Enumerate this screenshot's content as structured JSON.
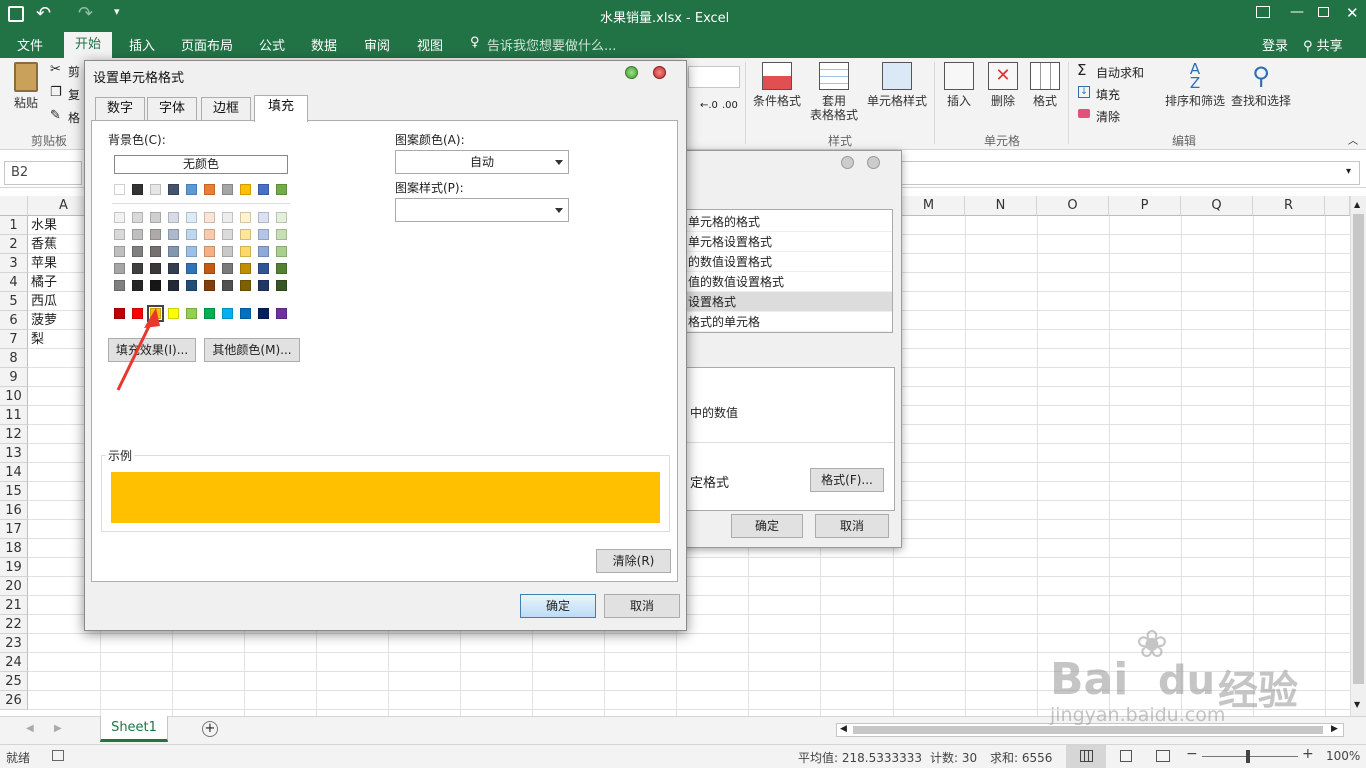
{
  "window": {
    "title": "水果销量.xlsx - Excel",
    "login": "登录",
    "share": "共享"
  },
  "ribbon_tabs": [
    "文件",
    "开始",
    "插入",
    "页面布局",
    "公式",
    "数据",
    "审阅",
    "视图"
  ],
  "tell_me": "告诉我您想要做什么...",
  "clipboard": {
    "paste": "粘贴",
    "cut": "剪",
    "copy": "复",
    "painter": "格",
    "group": "剪贴板"
  },
  "styles": {
    "cond": "条件格式",
    "table_a": "套用",
    "table_b": "表格格式",
    "cell_style": "单元格样式",
    "group": "样式"
  },
  "cells_group": {
    "insert": "插入",
    "delete": "删除",
    "format": "格式",
    "group": "单元格"
  },
  "editing": {
    "autosum": "自动求和",
    "fill": "填充",
    "clear": "清除",
    "sort": "排序和筛选",
    "find": "查找和选择",
    "group": "编辑"
  },
  "namebox": "B2",
  "columns_left": [
    "A"
  ],
  "columns_right": [
    "M",
    "N",
    "O",
    "P",
    "Q",
    "R"
  ],
  "rows": [
    "1",
    "2",
    "3",
    "4",
    "5",
    "6",
    "7",
    "8",
    "9",
    "10",
    "11",
    "12",
    "13",
    "14",
    "15",
    "16",
    "17",
    "18",
    "19",
    "20",
    "21",
    "22",
    "23",
    "24",
    "25",
    "26"
  ],
  "colA": [
    "水果",
    "香蕉",
    "苹果",
    "橘子",
    "西瓜",
    "菠萝",
    "梨"
  ],
  "sheet_tab": "Sheet1",
  "status": {
    "ready": "就绪",
    "avg": "平均值: 218.5333333",
    "count": "计数: 30",
    "sum": "求和: 6556",
    "zoom": "100%"
  },
  "back_dialog": {
    "rules": [
      "单元格的格式",
      "单元格设置格式",
      "的数值设置格式",
      "值的数值设置格式",
      "设置格式",
      "格式的单元格"
    ],
    "desc": "中的数值",
    "preview_label": "定格式",
    "format_btn": "格式(F)...",
    "ok": "确定",
    "cancel": "取消"
  },
  "dialog": {
    "title": "设置单元格格式",
    "tabs": [
      "数字",
      "字体",
      "边框",
      "填充"
    ],
    "bg_label": "背景色(C):",
    "no_color": "无颜色",
    "pattern_color_label": "图案颜色(A):",
    "pattern_color_value": "自动",
    "pattern_style_label": "图案样式(P):",
    "fill_effects": "填充效果(I)...",
    "more_colors": "其他颜色(M)...",
    "sample_label": "示例",
    "sample_color": "#FFC000",
    "clear": "清除(R)",
    "ok": "确定",
    "cancel": "取消",
    "theme_top": [
      "#FFFFFF",
      "#333333",
      "#E7E6E6",
      "#44546A",
      "#5B9BD5",
      "#ED7D31",
      "#A5A5A5",
      "#FFC000",
      "#4472C4",
      "#70AD47"
    ],
    "theme_shades": [
      [
        "#F2F2F2",
        "#D9D9D9",
        "#D0CECE",
        "#D6DCE4",
        "#DDEBF7",
        "#FCE4D6",
        "#EDEDED",
        "#FFF2CC",
        "#D9E1F2",
        "#E2EFDA"
      ],
      [
        "#D9D9D9",
        "#BFBFBF",
        "#AEAAAA",
        "#ACB9CA",
        "#BDD7EE",
        "#F8CBAD",
        "#DBDBDB",
        "#FFE699",
        "#B4C6E7",
        "#C6E0B4"
      ],
      [
        "#BFBFBF",
        "#808080",
        "#757171",
        "#8497B0",
        "#9BC2E6",
        "#F4B084",
        "#C9C9C9",
        "#FFD966",
        "#8EA9DB",
        "#A9D08E"
      ],
      [
        "#A6A6A6",
        "#404040",
        "#3A3838",
        "#333F4F",
        "#2F75B5",
        "#C65911",
        "#7B7B7B",
        "#BF8F00",
        "#305496",
        "#548235"
      ],
      [
        "#808080",
        "#262626",
        "#161616",
        "#222B35",
        "#1F4E78",
        "#833C0C",
        "#525252",
        "#7F6000",
        "#203764",
        "#375623"
      ]
    ],
    "standard": [
      "#C00000",
      "#FF0000",
      "#FFC000",
      "#FFFF00",
      "#92D050",
      "#00B050",
      "#00B0F0",
      "#0070C0",
      "#002060",
      "#7030A0"
    ]
  },
  "watermark": {
    "brand": "Bai",
    "sub": "经验",
    "url": "jingyan.baidu.com"
  }
}
